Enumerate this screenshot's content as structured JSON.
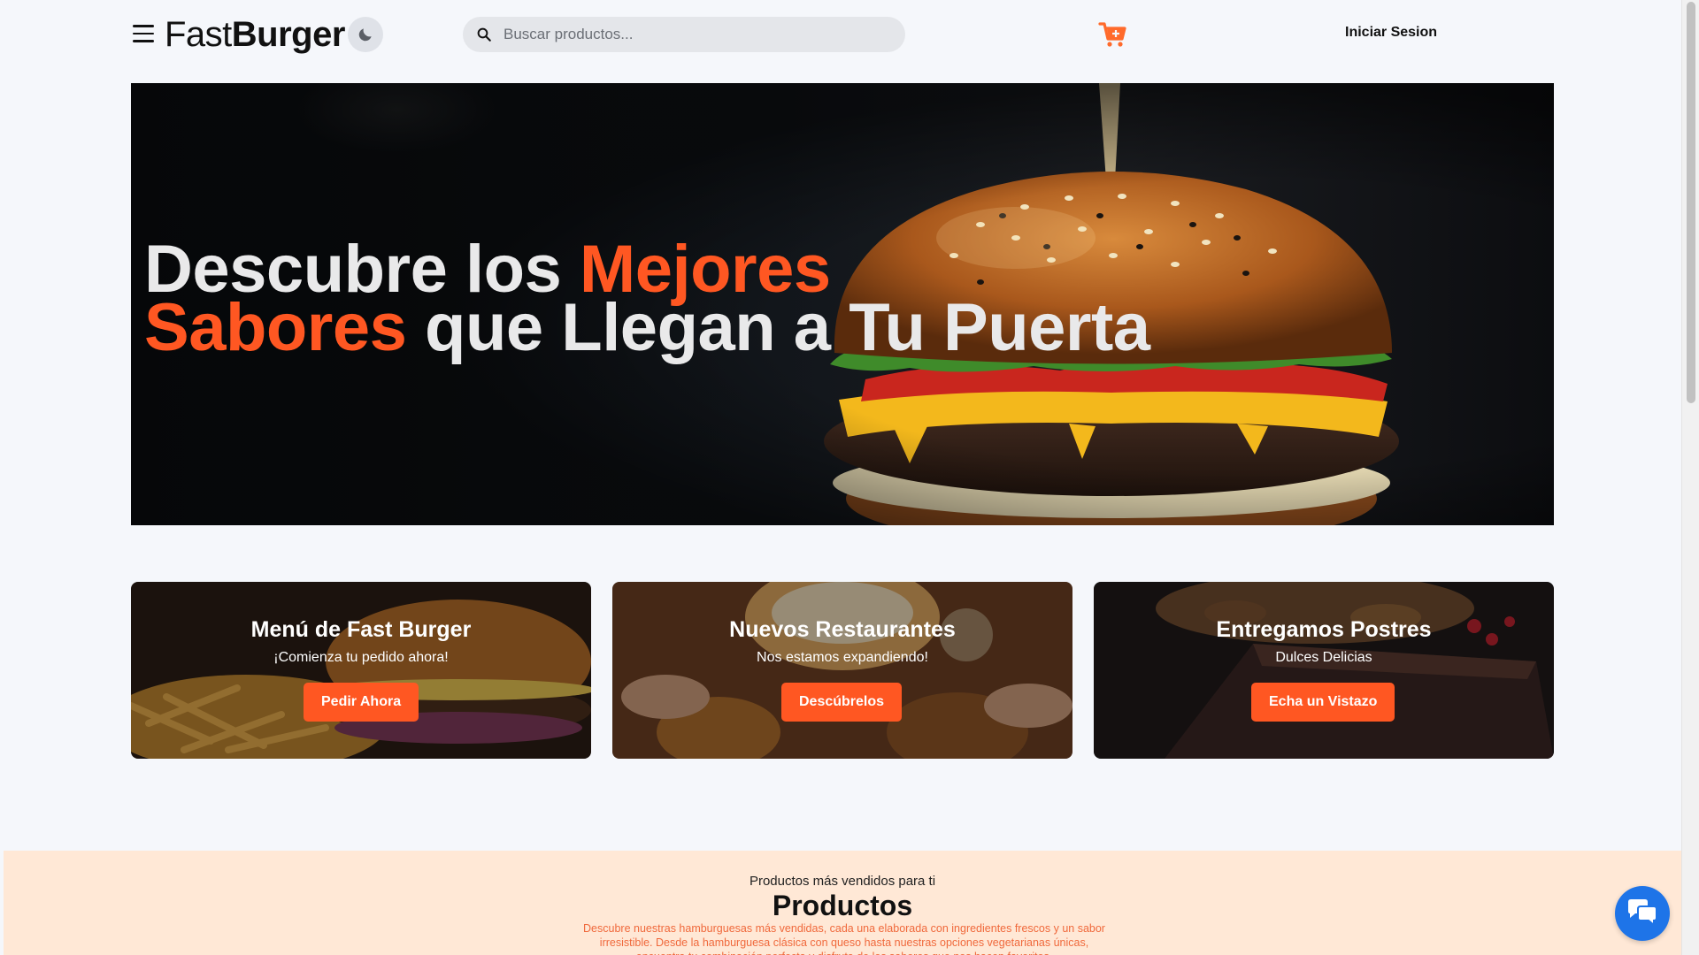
{
  "header": {
    "logo_part1": "Fast",
    "logo_part2": "Burger",
    "search_placeholder": "Buscar productos...",
    "login_label": "Iniciar Sesion",
    "icons": [
      "menu-icon",
      "moon-icon",
      "search-icon",
      "cart-icon"
    ]
  },
  "hero": {
    "line1_white": "Descubre los ",
    "line1_accent": "Mejores",
    "line2_accent": "Sabores",
    "line2_white": " que Llegan a Tu Puerta"
  },
  "promos": [
    {
      "title": "Menú de Fast Burger",
      "subtitle": "¡Comienza tu pedido ahora!",
      "button": "Pedir Ahora"
    },
    {
      "title": "Nuevos Restaurantes",
      "subtitle": "Nos estamos expandiendo!",
      "button": "Descúbrelos"
    },
    {
      "title": "Entregamos Postres",
      "subtitle": "Dulces Delicias",
      "button": "Echa un Vistazo"
    }
  ],
  "products": {
    "kicker": "Productos más vendidos para ti",
    "title": "Productos",
    "description": "Descubre nuestras hamburguesas más vendidas, cada una elaborada con ingredientes frescos y un sabor irresistible. Desde la hamburguesa clásica con queso hasta nuestras opciones vegetarianas únicas, encuentra tu combinación perfecta y disfruta de los sabores que nos hacen favoritos."
  },
  "colors": {
    "accent": "#ff5722",
    "background": "#f5f7fb",
    "products_bg": "#ffe8d6",
    "chat_button": "#1e74e8"
  }
}
